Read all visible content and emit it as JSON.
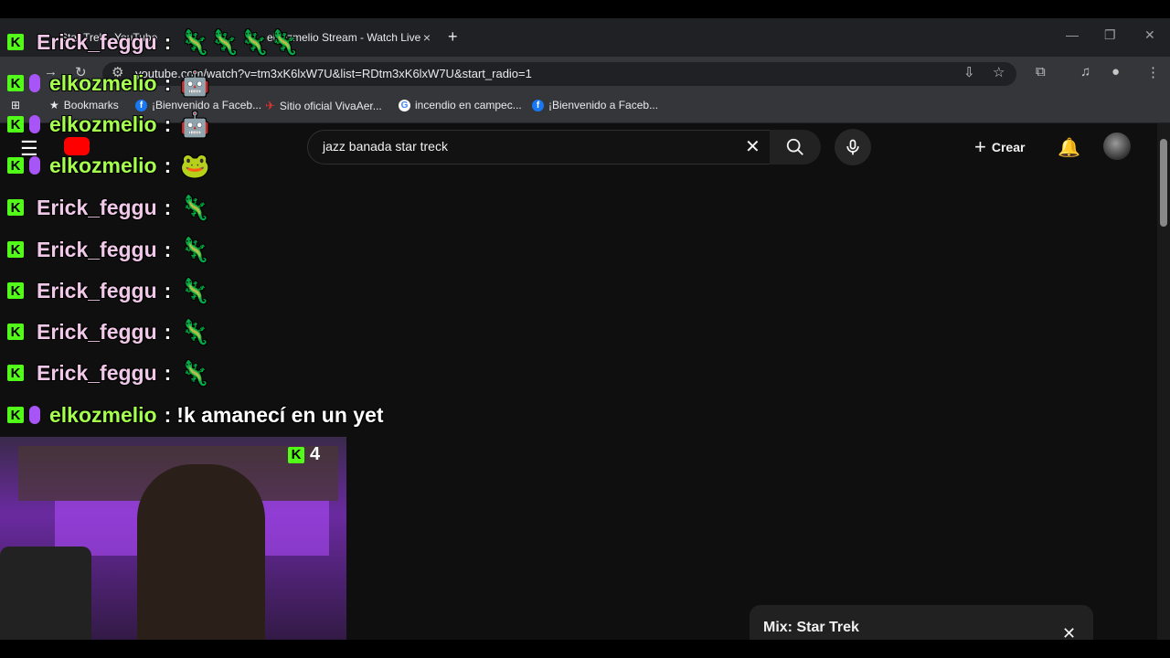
{
  "browser": {
    "tabs": [
      {
        "label": "Star Trek - YouTube",
        "close": "×"
      },
      {
        "label": "elkozmelio Stream - Watch Live",
        "close": "×"
      }
    ],
    "new_tab": "+",
    "url": "youtube.com/watch?v=tm3xK6lxW7U&list=RDtm3xK6lxW7U&start_radio=1",
    "bookmarks": [
      {
        "label": "Bookmarks",
        "icon": "star-icon"
      },
      {
        "label": "¡Bienvenido a Faceb...",
        "icon": "facebook-icon"
      },
      {
        "label": "Sitio oficial VivaAer...",
        "icon": "vivaaerobus-icon"
      },
      {
        "label": "incendio en campec...",
        "icon": "google-icon"
      },
      {
        "label": "¡Bienvenido a Faceb...",
        "icon": "facebook-icon"
      }
    ]
  },
  "youtube": {
    "search_value": "jazz banada star treck",
    "create_label": "Crear",
    "miniplayer_title": "Mix: Star Trek"
  },
  "chat": [
    {
      "user": "Erick_feggu",
      "kind": "e",
      "sep": ":",
      "emotes": "🦎🦎🦎🦎",
      "text": ""
    },
    {
      "user": "elkozmelio",
      "kind": "k",
      "sep": ":",
      "emotes": "🤖",
      "text": ""
    },
    {
      "user": "elkozmelio",
      "kind": "k",
      "sep": ":",
      "emotes": "🤖",
      "text": ""
    },
    {
      "user": "elkozmelio",
      "kind": "k",
      "sep": ":",
      "emotes": "🐸",
      "text": ""
    },
    {
      "user": "Erick_feggu",
      "kind": "e",
      "sep": ":",
      "emotes": "🦎",
      "text": ""
    },
    {
      "user": "Erick_feggu",
      "kind": "e",
      "sep": ":",
      "emotes": "🦎",
      "text": ""
    },
    {
      "user": "Erick_feggu",
      "kind": "e",
      "sep": ":",
      "emotes": "🦎",
      "text": ""
    },
    {
      "user": "Erick_feggu",
      "kind": "e",
      "sep": ":",
      "emotes": "🦎",
      "text": ""
    },
    {
      "user": "Erick_feggu",
      "kind": "e",
      "sep": ":",
      "emotes": "🦎",
      "text": ""
    },
    {
      "user": "elkozmelio",
      "kind": "k",
      "sep": ":",
      "emotes": "",
      "text": "!k amanecí en un yet"
    }
  ],
  "overlay": {
    "viewer_count": "4"
  },
  "colors": {
    "kick_green": "#53fc18",
    "mic_purple": "#a855f7"
  }
}
